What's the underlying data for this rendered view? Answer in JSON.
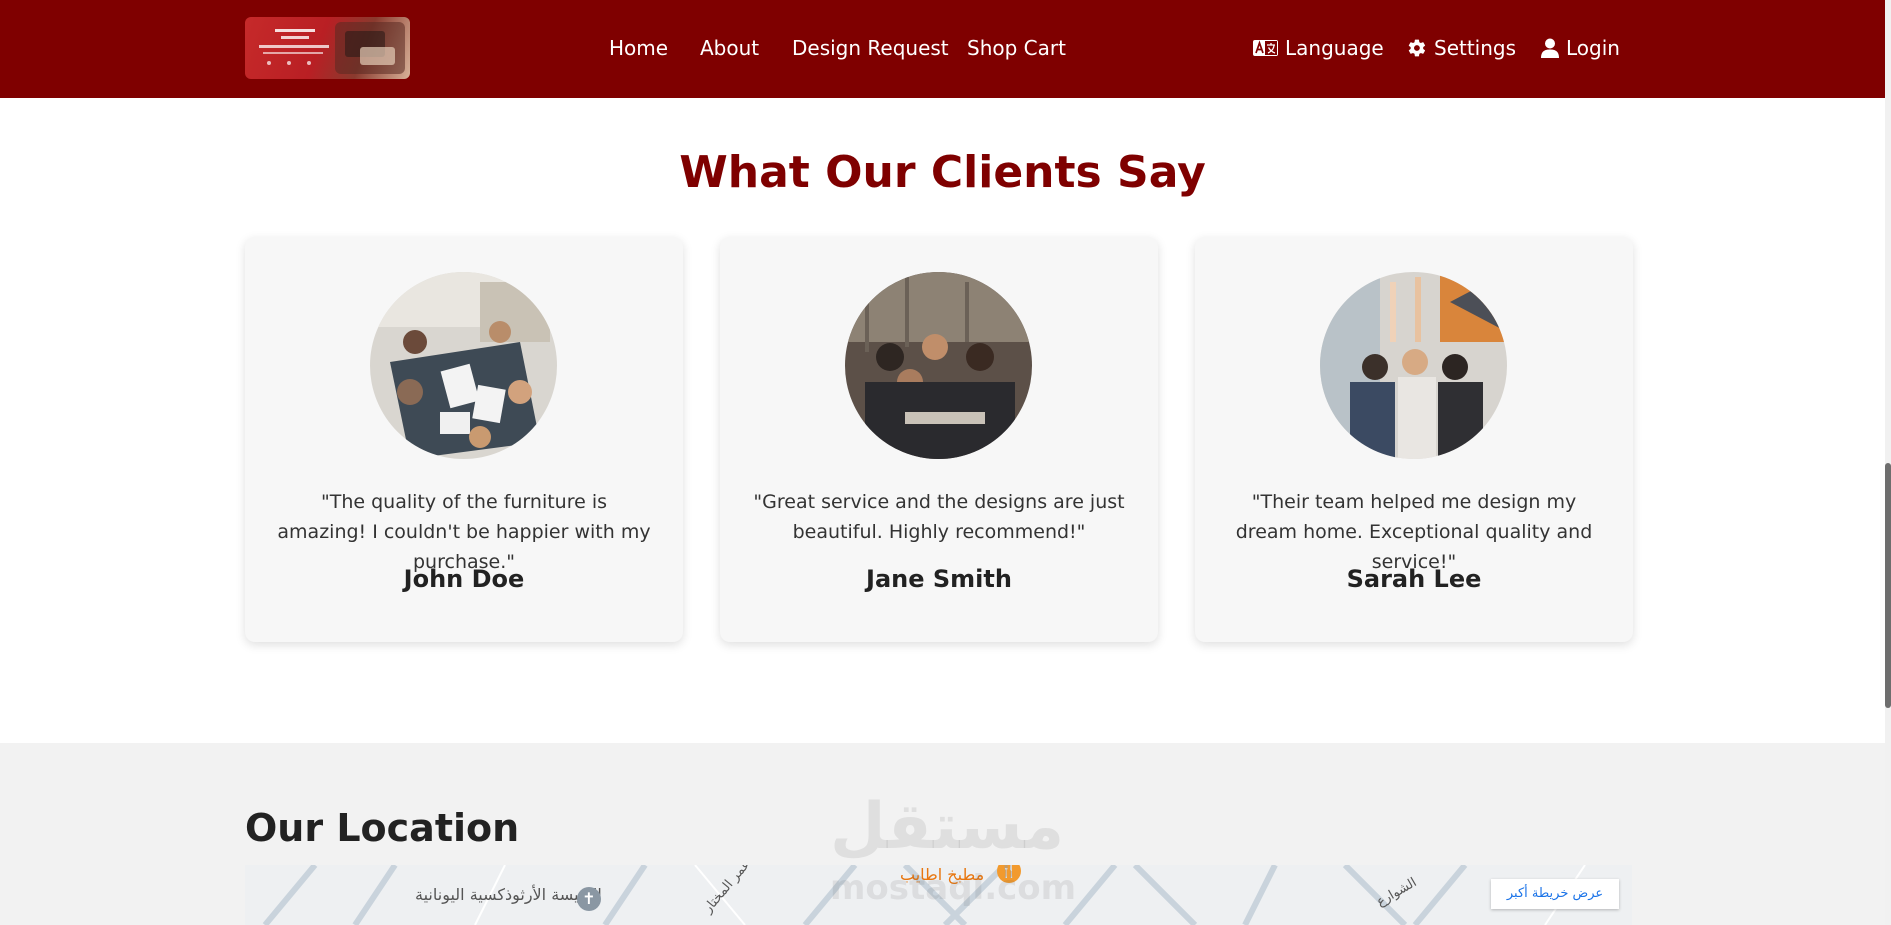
{
  "nav": {
    "links": [
      "Home",
      "About",
      "Design Request",
      "Shop Cart"
    ],
    "language": "Language",
    "settings": "Settings",
    "login": "Login"
  },
  "testimonials": {
    "title": "What Our Clients Say",
    "items": [
      {
        "quote": "\"The quality of the furniture is amazing! I couldn't be happier with my purchase.\"",
        "name": "John Doe"
      },
      {
        "quote": "\"Great service and the designs are just beautiful. Highly recommend!\"",
        "name": "Jane Smith"
      },
      {
        "quote": "\"Their team helped me design my dream home. Exceptional quality and service!\"",
        "name": "Sarah Lee"
      }
    ]
  },
  "location": {
    "title": "Our Location",
    "map_button": "عرض خريطة أكبر",
    "map_labels": [
      "الكنيسة الأرثوذكسية اليونانية",
      "مطبخ اطايب",
      "عمر المختار",
      "الشوارع"
    ]
  },
  "watermark": {
    "main": "مستقل",
    "sub": "mostaql.com"
  },
  "colors": {
    "brand": "#7f0000",
    "card_bg": "#f7f7f7",
    "section_bg": "#f2f2f2"
  },
  "icons": [
    "language-icon",
    "gear-icon",
    "user-icon",
    "church-icon",
    "restaurant-icon"
  ]
}
